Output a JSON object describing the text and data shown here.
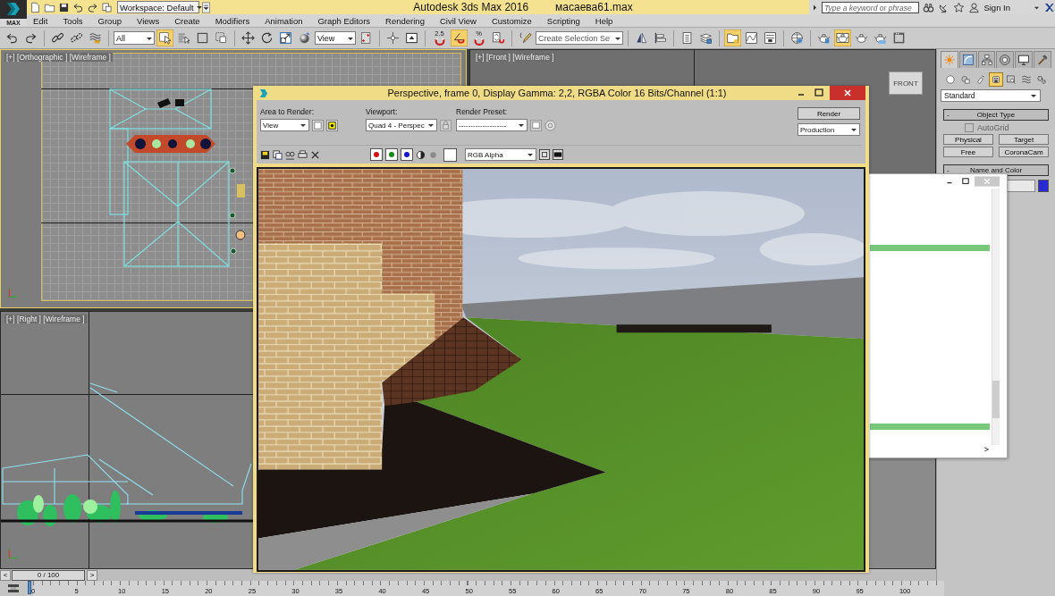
{
  "title_bar": {
    "logo_label": "MAX",
    "workspace": "Workspace: Default",
    "app_title": "Autodesk 3ds Max 2016",
    "file_name": "масаева61.max",
    "search": {
      "placeholder": "Type a keyword or phrase"
    },
    "sign_in": "Sign In"
  },
  "menu": [
    "Edit",
    "Tools",
    "Group",
    "Views",
    "Create",
    "Modifiers",
    "Animation",
    "Graph Editors",
    "Rendering",
    "Civil View",
    "Customize",
    "Scripting",
    "Help"
  ],
  "toolbar": [
    [
      {
        "kind": "undo",
        "selected": false
      },
      {
        "kind": "redo",
        "selected": false
      }
    ],
    [
      {
        "kind": "link",
        "selected": false
      },
      {
        "kind": "unlink",
        "selected": false
      },
      {
        "kind": "bind",
        "selected": false
      }
    ],
    [
      {
        "kind": "dropdown",
        "value": "All"
      },
      {
        "kind": "select",
        "selected": true
      },
      {
        "kind": "selname",
        "selected": false
      },
      {
        "kind": "rect",
        "selected": false
      },
      {
        "kind": "crossing",
        "selected": false
      }
    ],
    [
      {
        "kind": "move",
        "selected": false
      },
      {
        "kind": "rotate",
        "selected": false
      },
      {
        "kind": "scale",
        "selected": false
      },
      {
        "kind": "place",
        "selected": false
      },
      {
        "kind": "dropdown",
        "value": "View"
      },
      {
        "kind": "pivot",
        "selected": false
      }
    ],
    [
      {
        "kind": "manipulate",
        "selected": false
      },
      {
        "kind": "keyboard",
        "selected": false
      }
    ],
    [
      {
        "kind": "snap",
        "label": "2.5",
        "selected": false
      },
      {
        "kind": "anglesnap",
        "selected": true
      },
      {
        "kind": "snap",
        "label": "%",
        "selected": false
      },
      {
        "kind": "spinner",
        "selected": false
      }
    ],
    [
      {
        "kind": "namedsets",
        "selected": false
      },
      {
        "kind": "dropdown",
        "value": "Create Selection Se"
      }
    ],
    [
      {
        "kind": "mirror",
        "selected": false
      },
      {
        "kind": "align",
        "selected": false
      }
    ],
    [
      {
        "kind": "layerlist",
        "selected": false
      },
      {
        "kind": "layers",
        "selected": false
      }
    ],
    [
      {
        "kind": "explorer",
        "selected": true
      },
      {
        "kind": "curve",
        "selected": false
      },
      {
        "kind": "schematic",
        "selected": false
      }
    ],
    [
      {
        "kind": "material",
        "selected": false
      }
    ],
    [
      {
        "kind": "rsetup",
        "selected": false
      },
      {
        "kind": "frame",
        "selected": true
      },
      {
        "kind": "render",
        "selected": false
      },
      {
        "kind": "cloud",
        "selected": false
      },
      {
        "kind": "sun",
        "selected": false
      }
    ]
  ],
  "viewports": [
    {
      "kind": "top",
      "label": "[+] [Orthographic ] [Wireframe ]",
      "active": true
    },
    {
      "kind": "front",
      "label": "[+] [Front ] [Wireframe ]",
      "active": false,
      "cube_label": "FRONT"
    },
    {
      "kind": "right",
      "label": "[+] [Right ] [Wireframe ]",
      "active": false
    },
    {
      "kind": "perspective",
      "active": false
    }
  ],
  "timeline": {
    "prev": "<",
    "frame": "0 / 100",
    "next": ">",
    "ticks": [
      "0",
      "5",
      "10",
      "15",
      "20",
      "25",
      "30",
      "35",
      "40",
      "45",
      "50",
      "55",
      "60",
      "65",
      "70",
      "75",
      "80",
      "85",
      "90",
      "95",
      "100"
    ]
  },
  "command_panel": {
    "tabs": [
      {
        "kind": "create",
        "selected": true
      },
      {
        "kind": "modify",
        "selected": false
      },
      {
        "kind": "hierarchy",
        "selected": false
      },
      {
        "kind": "motion",
        "selected": false
      },
      {
        "kind": "display",
        "selected": false
      },
      {
        "kind": "utilities",
        "selected": false
      }
    ],
    "categories": [
      {
        "kind": "geometry",
        "selected": false
      },
      {
        "kind": "shapes",
        "selected": false
      },
      {
        "kind": "lights",
        "selected": false
      },
      {
        "kind": "cameras",
        "selected": true
      },
      {
        "kind": "helpers",
        "selected": false
      },
      {
        "kind": "spacewarps",
        "selected": false
      },
      {
        "kind": "systems",
        "selected": false
      }
    ],
    "type_dropdown": "Standard",
    "object_type": {
      "toggle": "-",
      "title": "Object Type",
      "autogrid": {
        "label": "AutoGrid",
        "checked": false,
        "disabled": true
      },
      "buttons": [
        "Physical",
        "Target",
        "Free",
        "CoronaCam"
      ]
    },
    "name_and_color": {
      "toggle": "-",
      "title": "Name and Color",
      "color": "#2a2ad2"
    }
  },
  "floating_window": {
    "scroll_right": ">"
  },
  "render_window": {
    "title": "Perspective, frame 0, Display Gamma: 2,2, RGBA Color 16 Bits/Channel (1:1)",
    "area_label": "Area to Render:",
    "area_value": "View",
    "viewport_label": "Viewport:",
    "viewport_value": "Quad 4 - Perspec",
    "preset_label": "Render Preset:",
    "preset_value": "--------------------",
    "render_button": "Render",
    "render_mode": "Production",
    "channels": [
      {
        "color": "#d21414",
        "selected": true
      },
      {
        "color": "#138a13",
        "selected": true
      },
      {
        "color": "#1414c8",
        "selected": true
      }
    ],
    "channel_display": "RGB Alpha"
  }
}
